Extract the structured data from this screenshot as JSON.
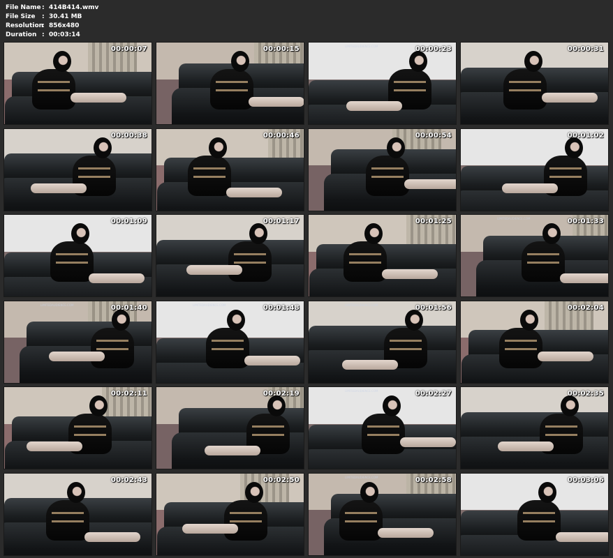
{
  "info": {
    "file_name_label": "File Name",
    "file_name_value": "414B414.wmv",
    "file_size_label": "File Size",
    "file_size_value": "30.41 MB",
    "resolution_label": "Resolution",
    "resolution_value": "856x480",
    "duration_label": "Duration",
    "duration_value": "00:03:14",
    "separator": ":"
  },
  "thumbnails": [
    {
      "time": "00:00:07"
    },
    {
      "time": "00:00:15"
    },
    {
      "time": "00:00:23"
    },
    {
      "time": "00:00:31"
    },
    {
      "time": "00:00:38"
    },
    {
      "time": "00:00:46"
    },
    {
      "time": "00:00:54"
    },
    {
      "time": "00:01:02"
    },
    {
      "time": "00:01:09"
    },
    {
      "time": "00:01:17"
    },
    {
      "time": "00:01:25"
    },
    {
      "time": "00:01:33"
    },
    {
      "time": "00:01:40"
    },
    {
      "time": "00:01:48"
    },
    {
      "time": "00:01:56"
    },
    {
      "time": "00:02:04"
    },
    {
      "time": "00:02:11"
    },
    {
      "time": "00:02:19"
    },
    {
      "time": "00:02:27"
    },
    {
      "time": "00:02:35"
    },
    {
      "time": "00:02:43"
    },
    {
      "time": "00:02:50"
    },
    {
      "time": "00:02:58"
    },
    {
      "time": "00:03:06"
    }
  ],
  "watermark": "LIMITEDAUDIENCE.COM",
  "colors": {
    "background": "#2b2b2b",
    "wall": "#c9c4bd",
    "floor": "#8a6f70",
    "sofa": "#16191b"
  }
}
